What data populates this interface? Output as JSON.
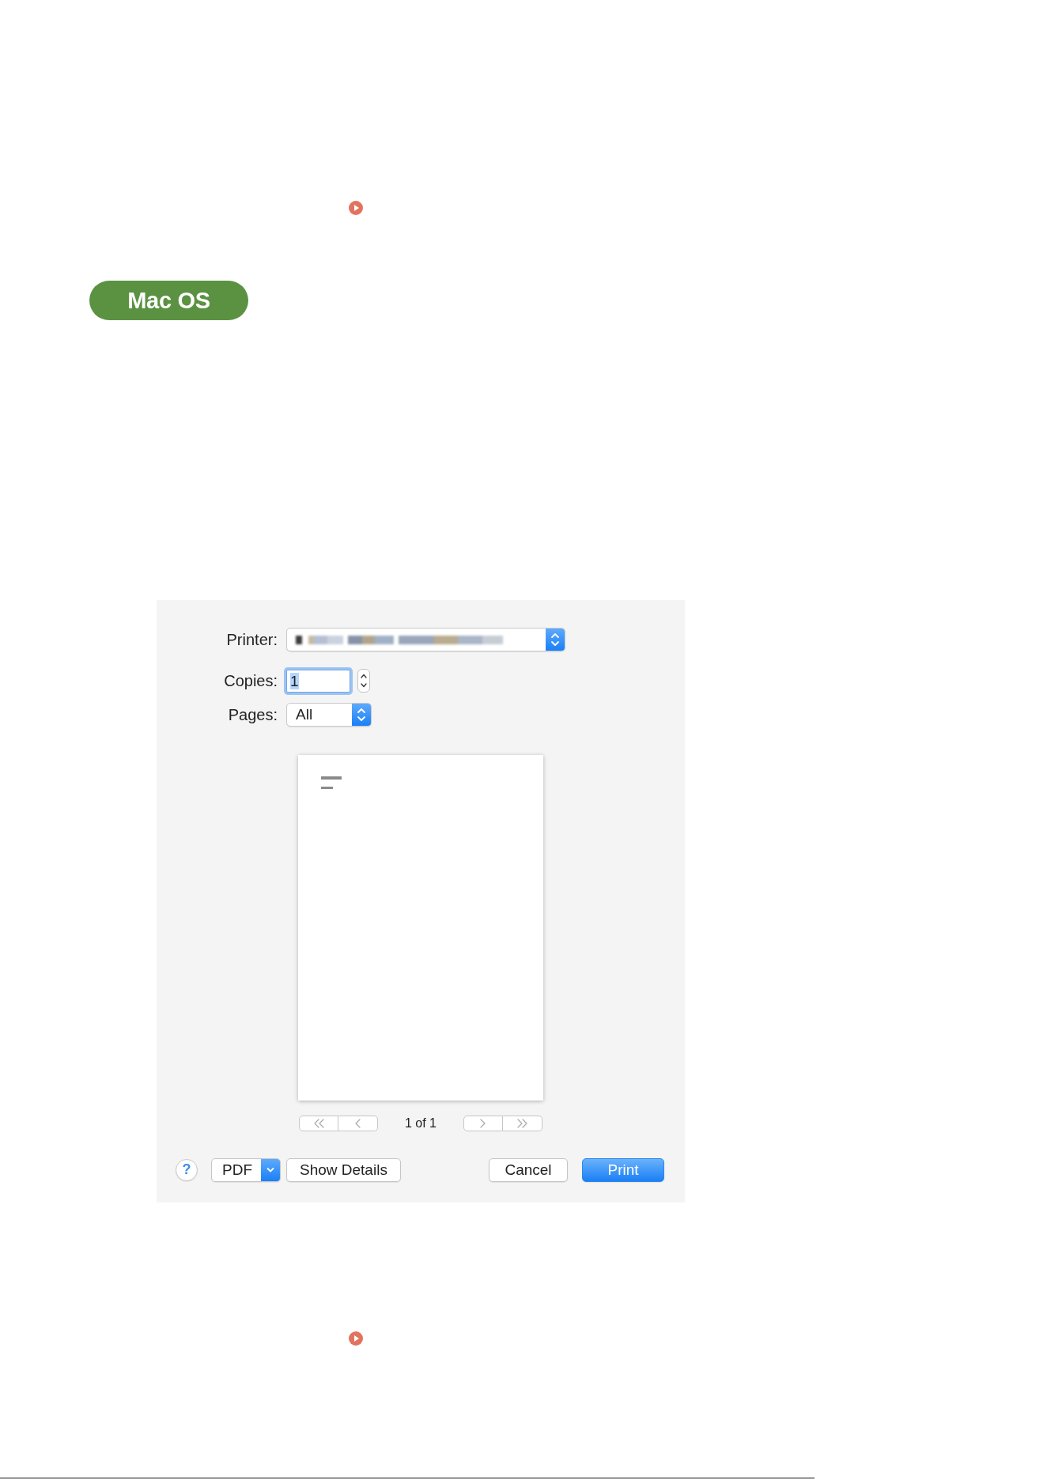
{
  "badge": {
    "label": "Mac OS"
  },
  "print_dialog": {
    "printer": {
      "label": "Printer:",
      "obscured": true
    },
    "copies": {
      "label": "Copies:",
      "value": "1",
      "focused": true
    },
    "pages": {
      "label": "Pages:",
      "value": "All"
    },
    "page_nav": {
      "buttons": [
        {
          "kind": "first",
          "disabled": true
        },
        {
          "kind": "previous",
          "disabled": true
        },
        {
          "kind": "next",
          "disabled": true
        },
        {
          "kind": "last",
          "disabled": true
        }
      ],
      "indicator": "1 of 1"
    },
    "help": {
      "label": "?"
    },
    "left_buttons": [
      {
        "kind": "menu",
        "label": "PDF"
      },
      {
        "kind": "plain",
        "label": "Show Details"
      }
    ],
    "right_buttons": [
      {
        "kind": "plain",
        "label": "Cancel"
      },
      {
        "kind": "default",
        "label": "Print"
      }
    ]
  }
}
